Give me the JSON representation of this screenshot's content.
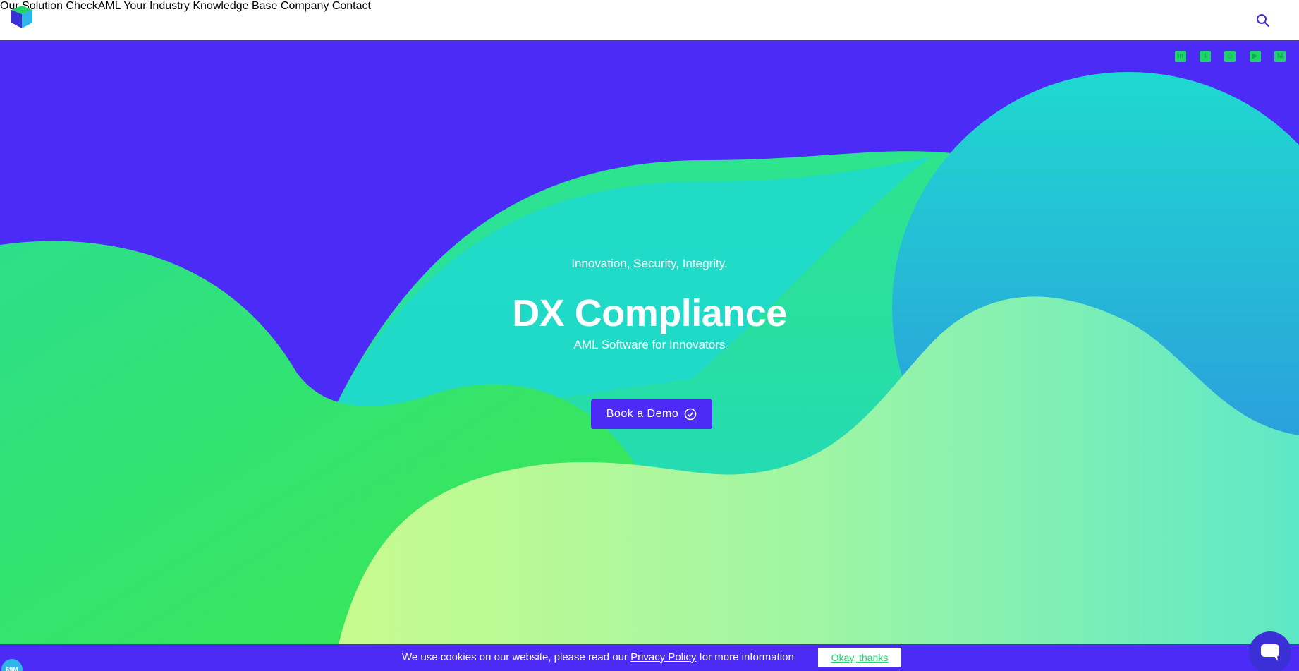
{
  "brand": {
    "logo": "logo-cube-icon",
    "accent": "#4b2bf5",
    "green": "#22d26a"
  },
  "nav": {
    "items": [
      "Our Solution",
      "CheckAML",
      "Your Industry",
      "Knowledge Base",
      "Company",
      "Contact"
    ],
    "search_icon": "search-icon"
  },
  "social": [
    "linkedin-icon",
    "twitter-icon",
    "instagram-icon",
    "youtube-icon",
    "medium-icon"
  ],
  "hero": {
    "tagline": "Innovation, Security, Integrity.",
    "title": "DX Compliance",
    "subtitle": "AML Software for Innovators",
    "cta_label": "Book a Demo",
    "cta_icon": "check-circle-icon"
  },
  "cookie": {
    "text_before": "We use cookies on our website, please read our ",
    "link": "Privacy Policy",
    "text_after": " for more information",
    "button": "Okay, thanks"
  },
  "badge": "69M",
  "chat_icon": "chat-icon"
}
